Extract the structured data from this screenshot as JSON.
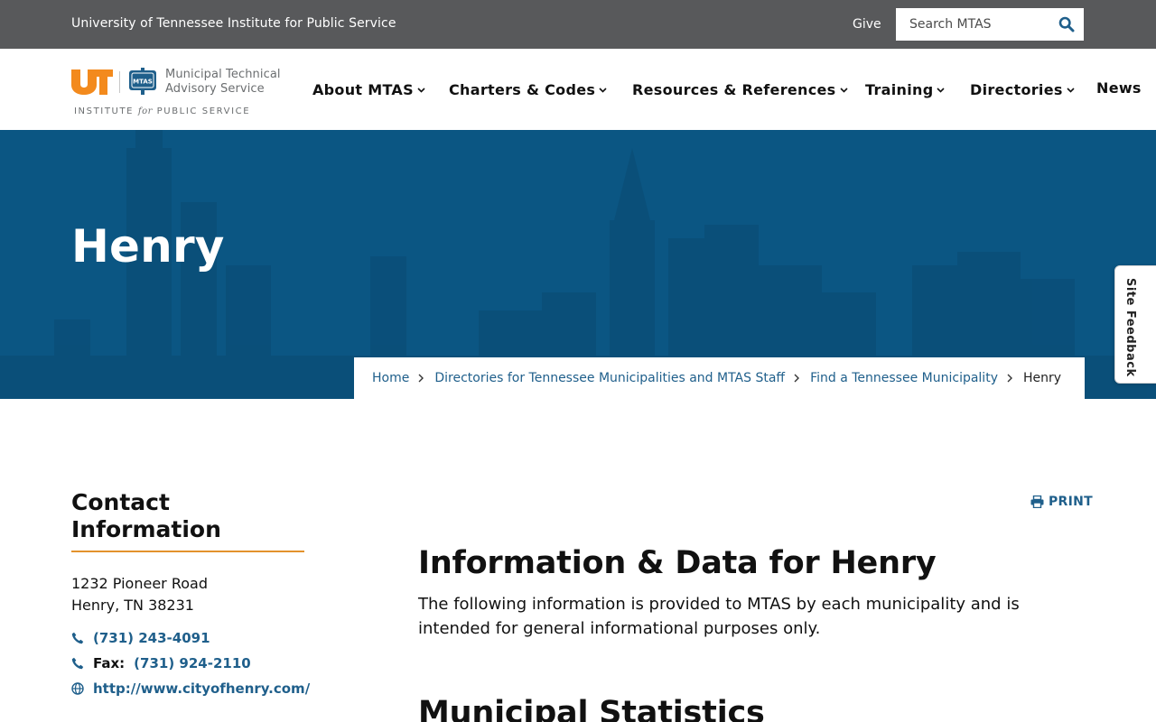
{
  "topbar": {
    "institute": "University of Tennessee Institute for Public Service",
    "give": "Give",
    "search_placeholder": "Search MTAS"
  },
  "logo": {
    "ut": "UT",
    "seal": "MTAS",
    "name_line1": "Municipal Technical",
    "name_line2": "Advisory Service",
    "ips_pre": "INSTITUTE ",
    "ips_for": "for",
    "ips_post": " PUBLIC SERVICE"
  },
  "nav": {
    "items": [
      {
        "label": "About MTAS"
      },
      {
        "label": "Charters & Codes"
      },
      {
        "label": "Resources & References"
      },
      {
        "label": "Training"
      },
      {
        "label": "Directories"
      },
      {
        "label": "News"
      }
    ]
  },
  "hero": {
    "title": "Henry"
  },
  "breadcrumb": {
    "items": [
      {
        "label": "Home"
      },
      {
        "label": "Directories for Tennessee Municipalities and MTAS Staff"
      },
      {
        "label": "Find a Tennessee Municipality"
      }
    ],
    "current": "Henry"
  },
  "feedback": {
    "label": "Site Feedback"
  },
  "contact": {
    "title": "Contact Information",
    "address_line1": "1232 Pioneer Road",
    "address_line2": "Henry, TN 38231",
    "phone": "(731) 243-4091",
    "fax_label": "Fax:",
    "fax": "(731) 924-2110",
    "website": "http://www.cityofhenry.com/"
  },
  "main": {
    "print_label": "PRINT",
    "heading": "Information & Data for Henry",
    "intro": "The following information is provided to MTAS by each municipality and is intended for general informational purposes only.",
    "heading2": "Municipal Statistics"
  },
  "colors": {
    "topbar": "#58595b",
    "hero": "#0b5683",
    "link": "#1f5f8b",
    "ut_orange": "#f38a1d",
    "accent_rule": "#e3922c"
  }
}
